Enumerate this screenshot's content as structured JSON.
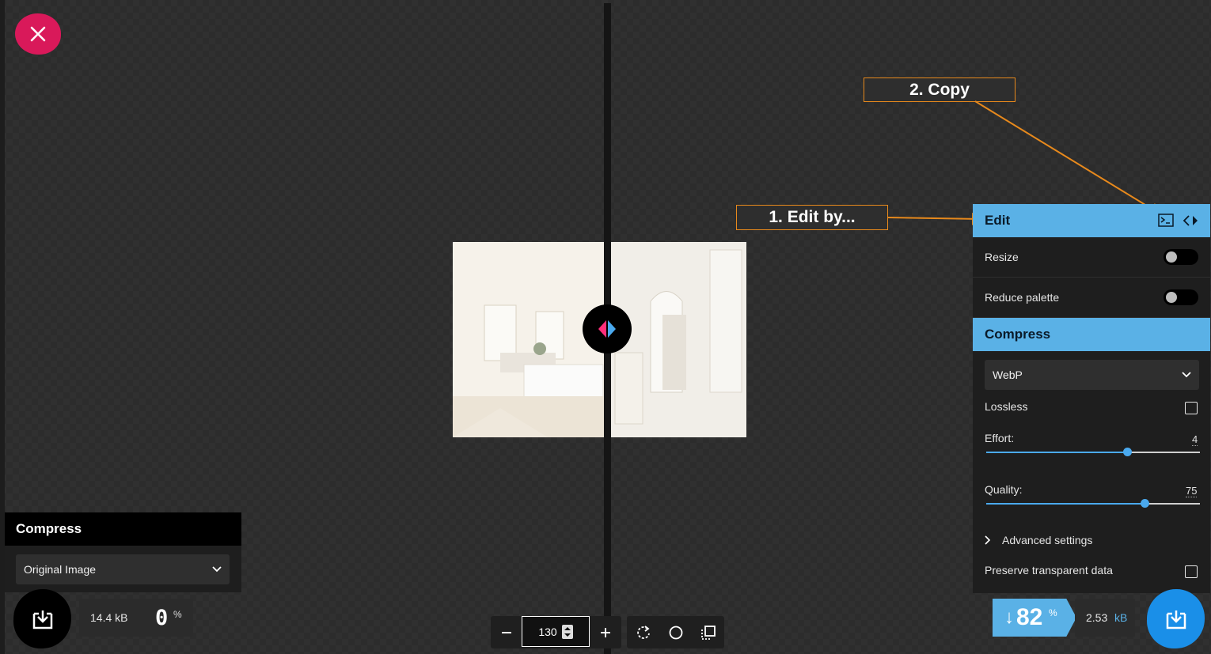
{
  "annotations": {
    "copy": "2. Copy",
    "edit": "1. Edit by..."
  },
  "edit_panel": {
    "title": "Edit",
    "resize_label": "Resize",
    "reduce_palette_label": "Reduce palette"
  },
  "compress_panel": {
    "title": "Compress",
    "format": "WebP",
    "lossless_label": "Lossless",
    "effort_label": "Effort:",
    "effort_value": "4",
    "effort_fraction": 0.66,
    "quality_label": "Quality:",
    "quality_value": "75",
    "quality_fraction": 0.74,
    "advanced_label": "Advanced settings",
    "preserve_label": "Preserve transparent data"
  },
  "left_panel": {
    "title": "Compress",
    "format": "Original Image",
    "size": "14.4 kB",
    "percent": "0",
    "percent_sign": "%"
  },
  "right_result": {
    "arrow": "↓",
    "percent": "82",
    "percent_sign": "%",
    "size_value": "2.53",
    "size_unit": "kB"
  },
  "zoom": {
    "value": "130"
  },
  "colors": {
    "accent_blue": "#5ab1e6",
    "close_pink": "#d9195a",
    "annotation_orange": "#e7891c"
  },
  "icons": {
    "close": "close-icon",
    "download": "download-icon",
    "terminal": "terminal-icon",
    "swap": "swap-arrows-icon",
    "rotate": "rotate-icon",
    "circle": "background-toggle-icon",
    "crop": "copy-settings-icon"
  }
}
